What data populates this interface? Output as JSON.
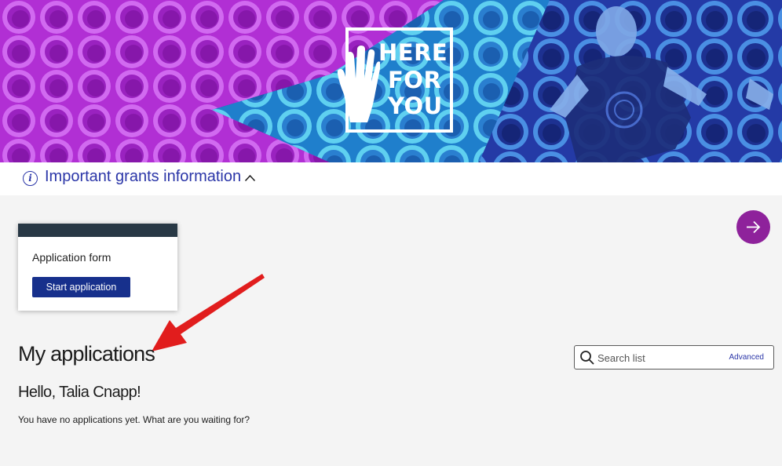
{
  "banner": {
    "logo_lines": [
      "HERE",
      "FOR",
      "YOU"
    ]
  },
  "info_bar": {
    "text": "Important grants information",
    "info_icon_glyph": "i"
  },
  "card": {
    "title": "Application form",
    "button_label": "Start application"
  },
  "my_applications": {
    "heading": "My applications",
    "greeting": "Hello, Talia Cnapp!",
    "empty_message": "You have no applications yet. What are you waiting for?"
  },
  "search": {
    "placeholder": "Search list",
    "advanced_label": "Advanced"
  },
  "icons": {
    "info": "info-icon",
    "chevron": "chevron-up-icon",
    "next": "arrow-right-icon",
    "search": "search-icon",
    "hand": "hand-icon"
  },
  "colors": {
    "accent_blue": "#2b36a8",
    "button_navy": "#17308c",
    "purple": "#8e229b",
    "card_header": "#283845",
    "annotation_red": "#e11d1d"
  }
}
